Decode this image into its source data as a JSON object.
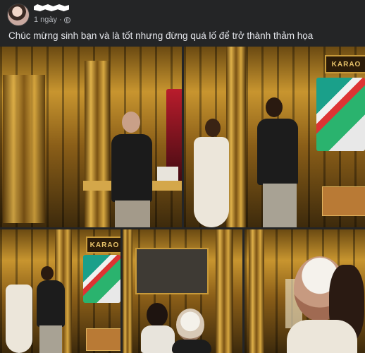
{
  "post": {
    "time": "1 ngày",
    "caption": "Chúc mừng sinh bạn và là tốt nhưng đừng quá lố để trở thành thảm họa"
  },
  "icons": {
    "avatar": "profile-avatar",
    "privacy": "globe-icon"
  },
  "photos": {
    "sign_text_1": "KARAO",
    "sign_text_2": "KARAO"
  },
  "colors": {
    "background": "#242526",
    "text_primary": "#e4e6eb",
    "text_secondary": "#b0b3b8"
  }
}
